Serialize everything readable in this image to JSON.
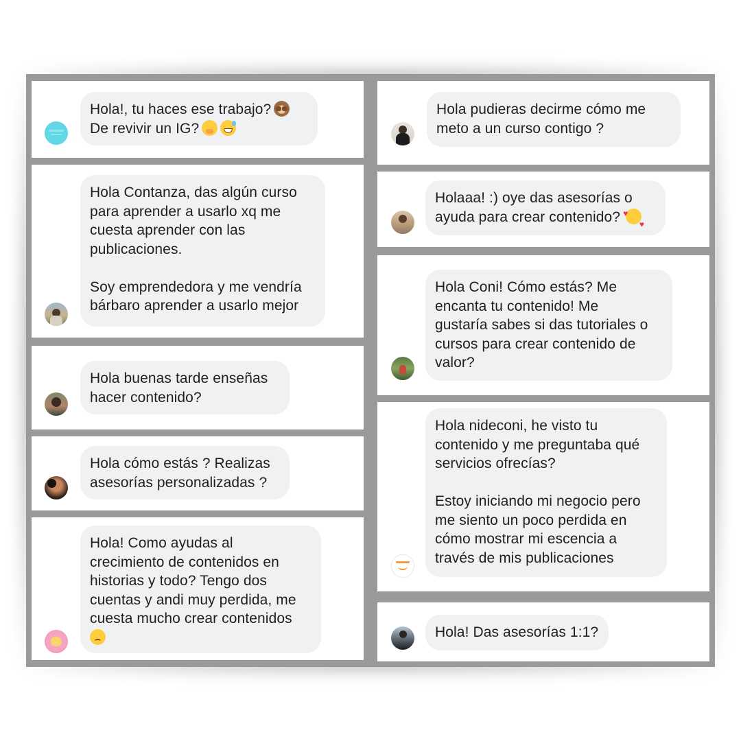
{
  "messages": [
    {
      "text": "Hola!, tu haces ese trabajo?",
      "text2": "De revivir un IG?",
      "emoji1": "see-no-evil-monkey-icon",
      "emoji2": "face-with-hand-over-mouth-icon",
      "emoji3": "grinning-face-with-sweat-icon"
    },
    {
      "text": "Hola Contanza, das algún curso\npara aprender a usarlo xq me\ncuesta aprender con las\npublicaciones.\n\nSoy emprendedora y me vendría\nbárbaro aprender a usarlo mejor"
    },
    {
      "text": "Hola buenas tarde enseñas\nhacer contenido?"
    },
    {
      "text": "Hola cómo estás ? Realizas\nasesorías personalizadas ?"
    },
    {
      "text": "Hola! Como ayudas al\ncrecimiento de contenidos en\nhistorias y todo? Tengo dos\ncuentas y andi muy perdida, me\ncuesta mucho crear contenidos",
      "emoji": "disappointed-face-icon"
    },
    {
      "text": "Hola pudieras decirme cómo me\nmeto a un curso contigo ?"
    },
    {
      "text": "Holaaa! :) oye das asesorías o",
      "text2": "ayuda para crear contenido?",
      "emoji": "smiling-face-with-hearts-icon"
    },
    {
      "text": "Hola Coni! Cómo estás? Me\nencanta tu contenido! Me\ngustaría sabes si das tutoriales o\ncursos para crear contenido de\nvalor?"
    },
    {
      "text": "Hola nideconi, he visto tu\ncontenido y me preguntaba qué\nservicios ofrecías?\n\nEstoy iniciando mi negocio pero\nme siento un poco perdida en\ncómo mostrar mi escencia a\ntravés de mis publicaciones"
    },
    {
      "text": "Hola! Das asesorías 1:1?"
    }
  ],
  "colors": {
    "bubble": "#eff1f2",
    "text": "#1f1f1f",
    "frame": "#9a9a9a",
    "card": "#ffffff"
  }
}
